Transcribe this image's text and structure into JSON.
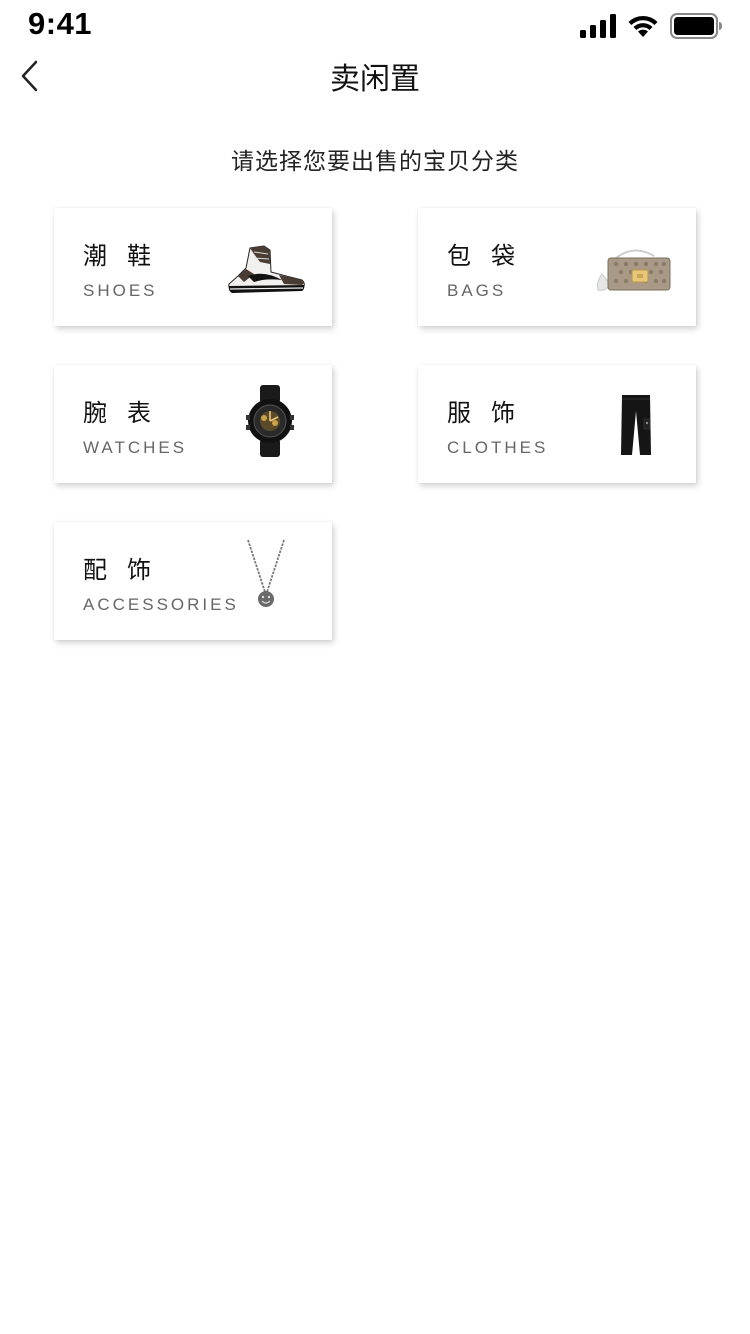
{
  "status_bar": {
    "time": "9:41"
  },
  "nav": {
    "title": "卖闲置"
  },
  "subtitle": "请选择您要出售的宝贝分类",
  "categories": [
    {
      "zh": "潮鞋",
      "en": "SHOES"
    },
    {
      "zh": "包袋",
      "en": "BAGS"
    },
    {
      "zh": "腕表",
      "en": "WATCHES"
    },
    {
      "zh": "服饰",
      "en": "CLOTHES"
    },
    {
      "zh": "配饰",
      "en": "ACCESSORIES"
    }
  ]
}
